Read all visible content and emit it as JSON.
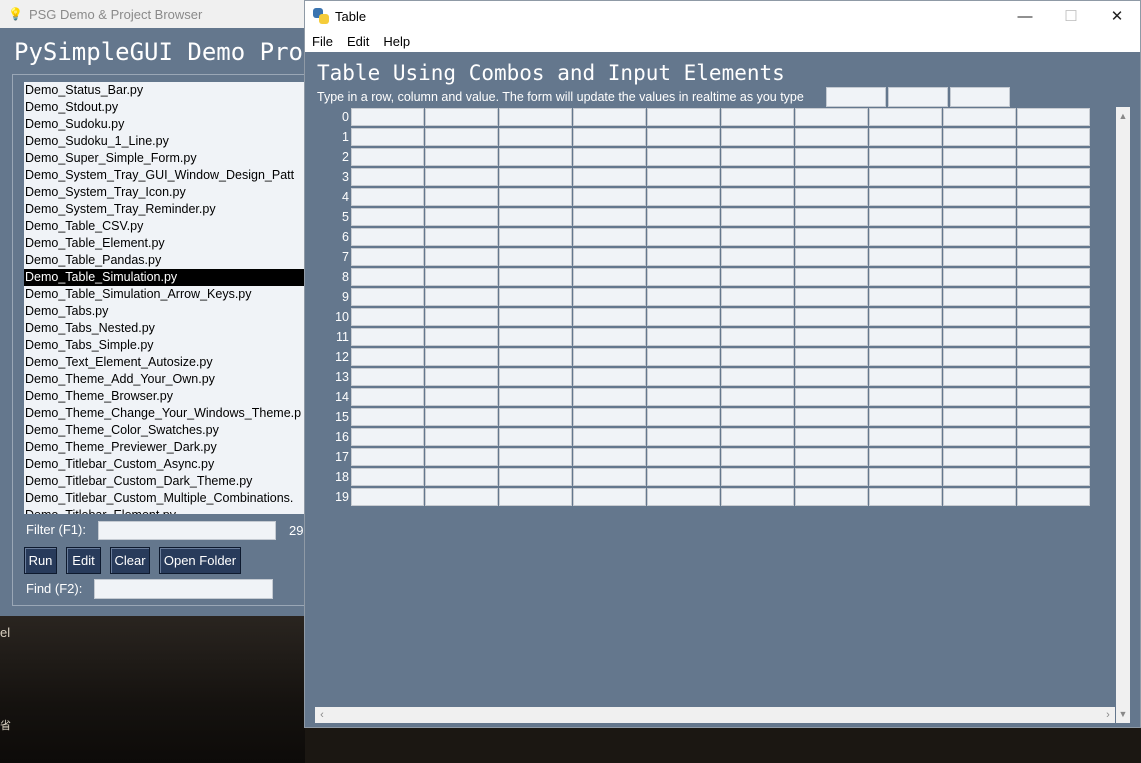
{
  "back_window": {
    "title": "PSG Demo & Project Browser",
    "heading": "PySimpleGUI Demo Prog",
    "items": [
      "Demo_Status_Bar.py",
      "Demo_Stdout.py",
      "Demo_Sudoku.py",
      "Demo_Sudoku_1_Line.py",
      "Demo_Super_Simple_Form.py",
      "Demo_System_Tray_GUI_Window_Design_Patt",
      "Demo_System_Tray_Icon.py",
      "Demo_System_Tray_Reminder.py",
      "Demo_Table_CSV.py",
      "Demo_Table_Element.py",
      "Demo_Table_Pandas.py",
      "Demo_Table_Simulation.py",
      "Demo_Table_Simulation_Arrow_Keys.py",
      "Demo_Tabs.py",
      "Demo_Tabs_Nested.py",
      "Demo_Tabs_Simple.py",
      "Demo_Text_Element_Autosize.py",
      "Demo_Theme_Add_Your_Own.py",
      "Demo_Theme_Browser.py",
      "Demo_Theme_Change_Your_Windows_Theme.p",
      "Demo_Theme_Color_Swatches.py",
      "Demo_Theme_Previewer_Dark.py",
      "Demo_Titlebar_Custom_Async.py",
      "Demo_Titlebar_Custom_Dark_Theme.py",
      "Demo_Titlebar_Custom_Multiple_Combinations.",
      "Demo_Titlebar_Element.py"
    ],
    "selected_index": 11,
    "filter_label": "Filter (F1):",
    "filter_value": "",
    "count": "29",
    "buttons": {
      "run": "Run",
      "edit": "Edit",
      "clear": "Clear",
      "open_folder": "Open Folder"
    },
    "find_label": "Find (F2):",
    "find_value": ""
  },
  "front_window": {
    "title": "Table",
    "menu": {
      "file": "File",
      "edit": "Edit",
      "help": "Help"
    },
    "heading": "Table Using Combos and Input Elements",
    "instructions": "Type in a row, column and value. The form will update the values in realtime as you type",
    "row_labels": [
      "0",
      "1",
      "2",
      "3",
      "4",
      "5",
      "6",
      "7",
      "8",
      "9",
      "10",
      "11",
      "12",
      "13",
      "14",
      "15",
      "16",
      "17",
      "18",
      "19"
    ],
    "column_count": 10,
    "controls": {
      "minimize": "—",
      "maximize": "☐",
      "close": "✕"
    }
  },
  "desktop": {
    "mark1": "el",
    "mark2": "省"
  },
  "colors": {
    "window_bg": "#64778d",
    "button_bg": "#283b5b",
    "input_bg": "#f0f3f7"
  }
}
